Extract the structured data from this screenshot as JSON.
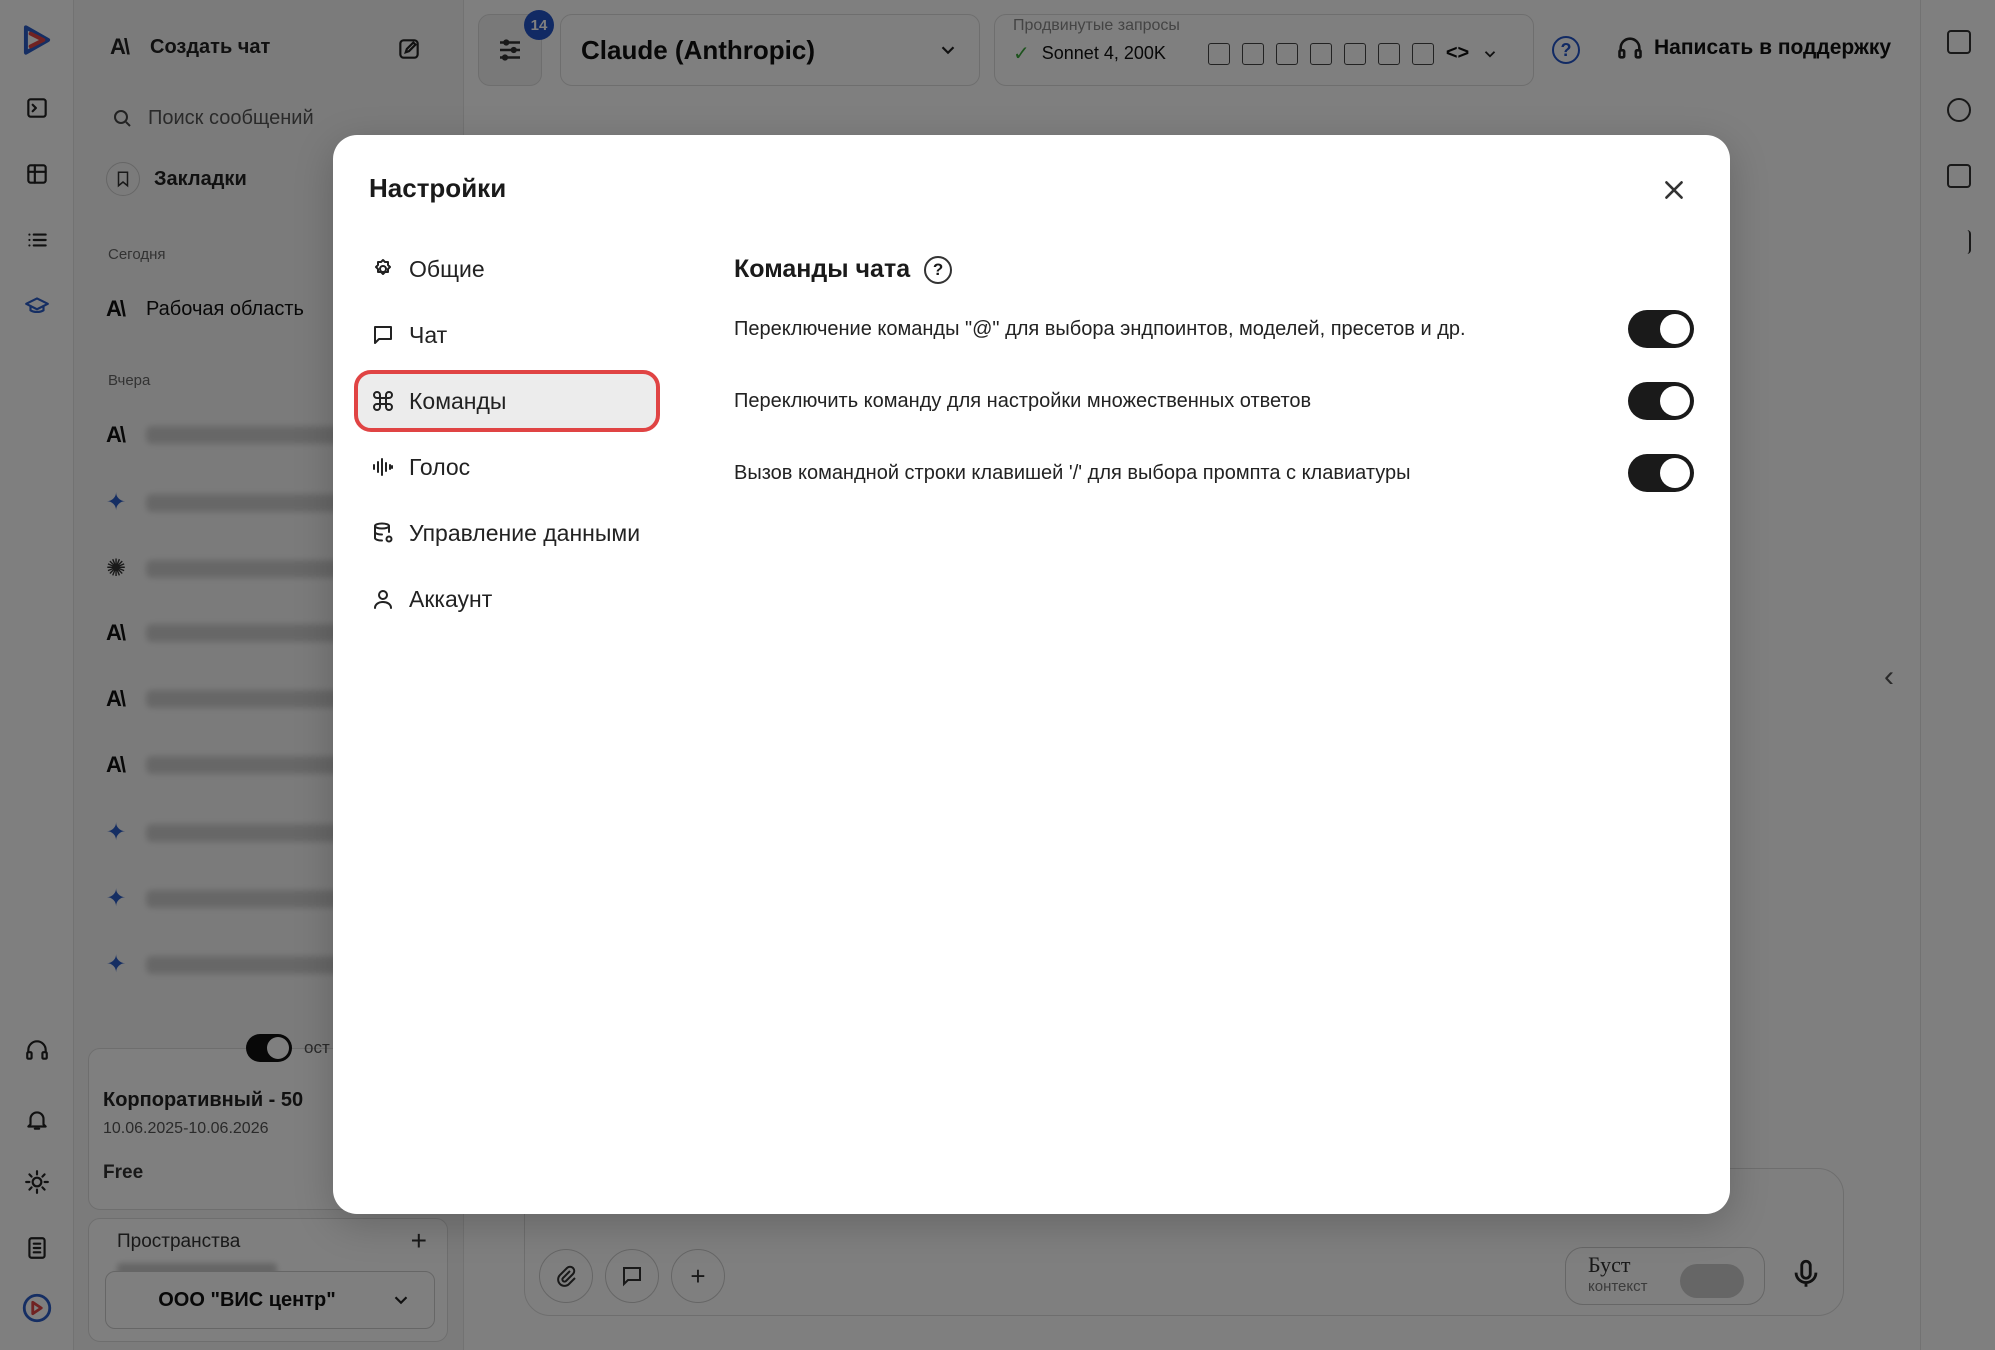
{
  "sidebar": {
    "new_chat": "Создать чат",
    "search_placeholder": "Поиск сообщений",
    "bookmarks": "Закладки",
    "today_label": "Сегодня",
    "workspace": "Рабочая область",
    "yesterday_label": "Вчера",
    "toggle_label": "ост",
    "plan_name": "Корпоративный - 50",
    "plan_dates": "10.06.2025-10.06.2026",
    "plan_tier": "Free",
    "spaces_label": "Пространства",
    "spaces_plus": "+",
    "org_name": "ООО \"ВИС центр\""
  },
  "topbar": {
    "filter_badge": "14",
    "model_name": "Claude (Anthropic)",
    "advanced_caption": "Продвинутые запросы",
    "advanced_model": "Sonnet 4, 200K",
    "help_icon": "?",
    "support_label": "Написать в поддержку"
  },
  "composer": {
    "boost_label": "Буст",
    "boost_sub": "контекст",
    "add_icon": "+"
  },
  "modal": {
    "title": "Настройки",
    "nav": [
      {
        "label": "Общие",
        "icon": "gear-icon"
      },
      {
        "label": "Чат",
        "icon": "chat-bubble-icon"
      },
      {
        "label": "Команды",
        "icon": "command-icon"
      },
      {
        "label": "Голос",
        "icon": "waveform-icon"
      },
      {
        "label": "Управление данными",
        "icon": "database-icon"
      },
      {
        "label": "Аккаунт",
        "icon": "user-icon"
      }
    ],
    "active_nav": "Команды",
    "section_title": "Команды чата",
    "help_icon": "?",
    "settings": [
      {
        "label": "Переключение команды \"@\" для выбора эндпоинтов, моделей, пресетов и др.",
        "enabled": true
      },
      {
        "label": "Переключить команду для настройки множественных ответов",
        "enabled": true
      },
      {
        "label": "Вызов командной строки клавишей '/' для выбора промпта с клавиатуры",
        "enabled": true
      }
    ]
  },
  "colors": {
    "accent": "#2354c9",
    "highlight": "#e04444",
    "toggle_on": "#1a1a1a"
  }
}
